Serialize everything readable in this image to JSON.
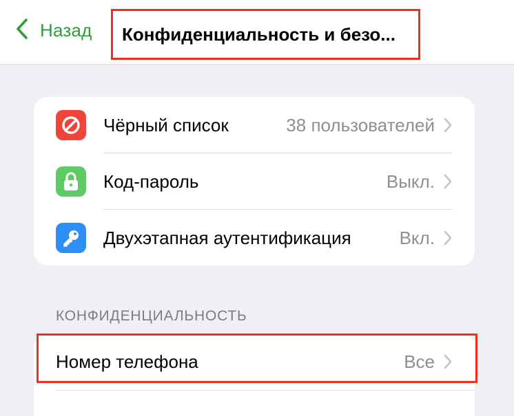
{
  "navbar": {
    "back_label": "Назад",
    "title": "Конфиденциальность и безо..."
  },
  "security_items": [
    {
      "label": "Чёрный список",
      "value": "38 пользователей",
      "icon": "block-icon",
      "icon_color": "#f0453a"
    },
    {
      "label": "Код-пароль",
      "value": "Выкл.",
      "icon": "lock-icon",
      "icon_color": "#5ecb64"
    },
    {
      "label": "Двухэтапная аутентификация",
      "value": "Вкл.",
      "icon": "key-icon",
      "icon_color": "#2f8ef5"
    }
  ],
  "privacy_section": {
    "header": "КОНФИДЕНЦИАЛЬНОСТЬ",
    "items": [
      {
        "label": "Номер телефона",
        "value": "Все"
      }
    ]
  },
  "colors": {
    "accent": "#2f9e3a",
    "highlight": "#e8321f",
    "background": "#efeff4"
  }
}
